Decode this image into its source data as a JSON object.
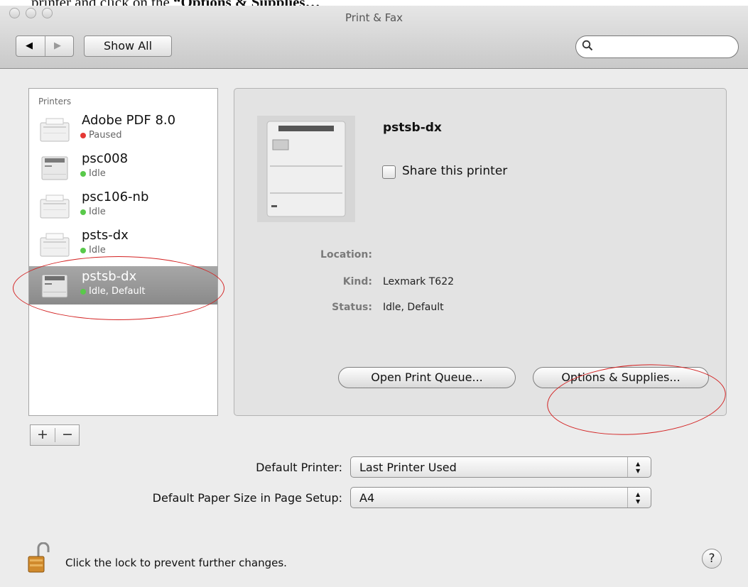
{
  "caption": {
    "prefix": "printer and click on the ",
    "bold": "“Options & Supplies…"
  },
  "window": {
    "title": "Print & Fax"
  },
  "toolbar": {
    "show_all": "Show All",
    "back_arrow": "◀",
    "forward_arrow": "▶",
    "search_placeholder": ""
  },
  "printers": {
    "heading": "Printers",
    "items": [
      {
        "name": "Adobe PDF 8.0",
        "status": "Paused",
        "status_color": "#e53935"
      },
      {
        "name": "psc008",
        "status": "Idle",
        "status_color": "#59c94a"
      },
      {
        "name": "psc106-nb",
        "status": "Idle",
        "status_color": "#59c94a"
      },
      {
        "name": "psts-dx",
        "status": "Idle",
        "status_color": "#59c94a"
      },
      {
        "name": "pstsb-dx",
        "status": "Idle, Default",
        "status_color": "#59c94a",
        "selected": true
      }
    ]
  },
  "detail": {
    "name": "pstsb-dx",
    "share_label": "Share this printer",
    "share_checked": false,
    "location_label": "Location:",
    "location_value": "",
    "kind_label": "Kind:",
    "kind_value": "Lexmark T622",
    "status_label": "Status:",
    "status_value": "Idle, Default",
    "open_queue_label": "Open Print Queue...",
    "options_label": "Options & Supplies..."
  },
  "list_controls": {
    "add": "+",
    "remove": "−"
  },
  "defaults": {
    "printer_label": "Default Printer:",
    "printer_value": "Last Printer Used",
    "paper_label": "Default Paper Size in Page Setup:",
    "paper_value": "A4"
  },
  "footer": {
    "lock_text": "Click the lock to prevent further changes.",
    "help": "?"
  },
  "colors": {
    "annotation": "#d32222",
    "selection": "#939393"
  }
}
